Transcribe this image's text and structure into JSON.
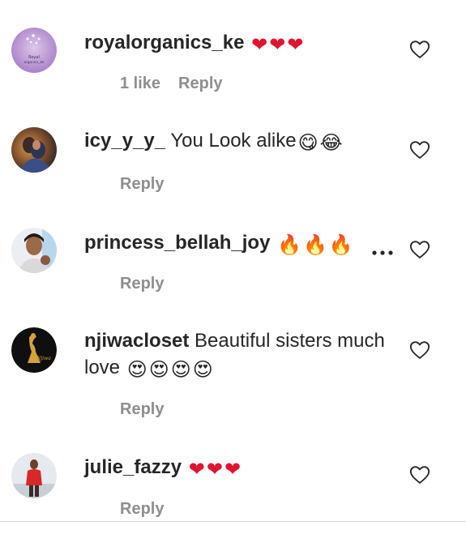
{
  "colors": {
    "primary_text": "#262626",
    "secondary_text": "#8e8e8e",
    "heart_red": "#e0142f"
  },
  "comments": [
    {
      "username": "royalorganics_ke",
      "text": "",
      "emoji": "❤❤❤",
      "avatar_text": [
        "Royal",
        "organics_ke"
      ],
      "likes": "1 like",
      "reply": "Reply"
    },
    {
      "username": "icy_y_y_",
      "text": "You Look alike",
      "emoji": "😋😂",
      "reply": "Reply"
    },
    {
      "username": "princess_bellah_joy",
      "text": "",
      "emoji": "🔥🔥🔥",
      "reply": "Reply",
      "more_icon": "more-horizontal-icon"
    },
    {
      "username": "njiwacloset",
      "text": "Beautiful sisters much love",
      "emoji": "😍😍😍😍",
      "avatar_text": "Njiwa",
      "reply": "Reply"
    },
    {
      "username": "julie_fazzy",
      "text": "",
      "emoji": "❤❤❤",
      "reply": "Reply"
    }
  ],
  "icons": {
    "like": "heart-outline-icon",
    "more": "more-horizontal-icon"
  }
}
